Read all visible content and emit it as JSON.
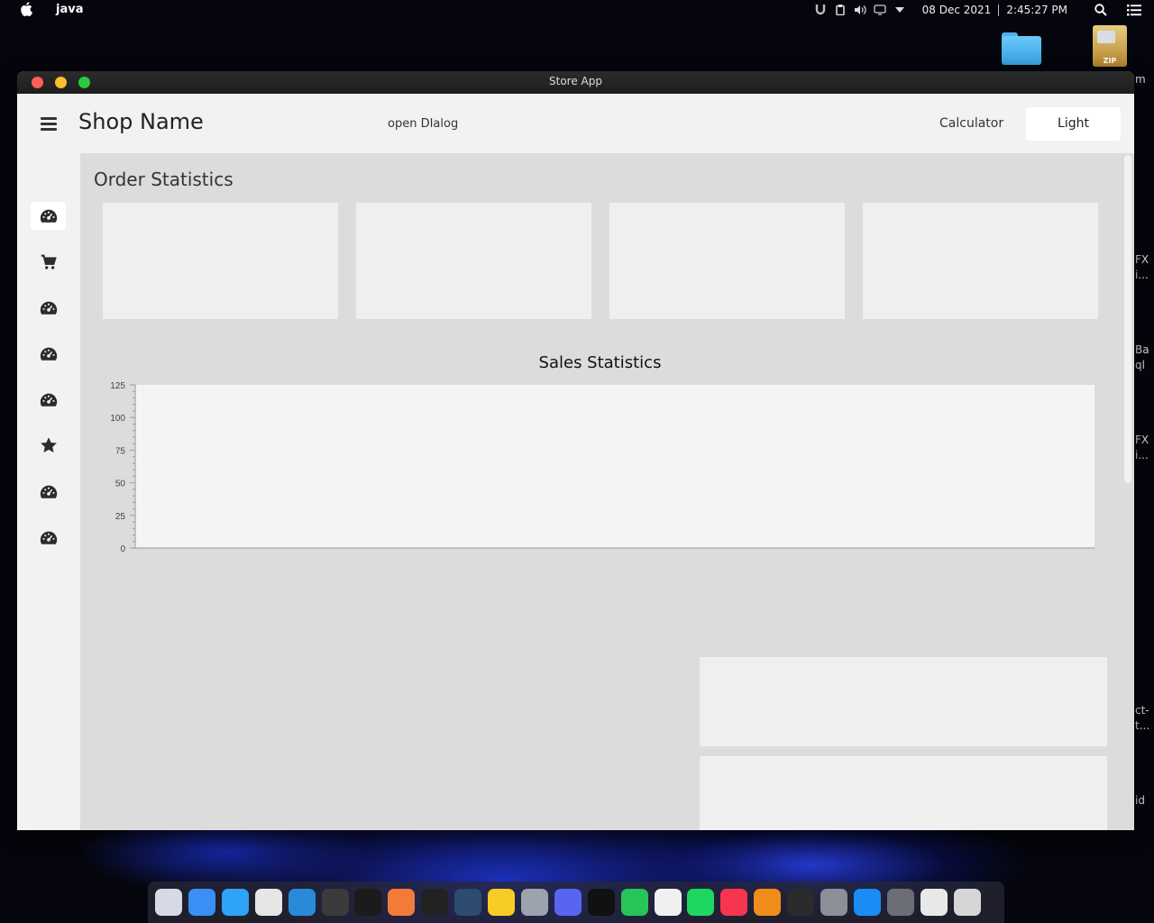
{
  "menubar": {
    "app_name": "java",
    "date": "08 Dec 2021",
    "time": "2:45:27 PM"
  },
  "desktop": {
    "zip_label": "ZIP",
    "peek_texts": [
      "m",
      "FX",
      "i...",
      "Ba",
      "ql",
      "FX",
      "i...",
      "ct-",
      "t...",
      "id"
    ]
  },
  "window": {
    "title": "Store App"
  },
  "header": {
    "shop_name": "Shop Name",
    "open_dialog_label": "open DIalog",
    "calculator_label": "Calculator",
    "theme_button_label": "Light"
  },
  "sidebar": {
    "items": [
      {
        "icon": "dashboard-icon",
        "active": true
      },
      {
        "icon": "cart-icon",
        "active": false
      },
      {
        "icon": "dashboard-icon",
        "active": false
      },
      {
        "icon": "dashboard-icon",
        "active": false
      },
      {
        "icon": "dashboard-icon",
        "active": false
      },
      {
        "icon": "star-icon",
        "active": false
      },
      {
        "icon": "dashboard-icon",
        "active": false
      },
      {
        "icon": "dashboard-icon",
        "active": false
      }
    ]
  },
  "main": {
    "order_statistics_title": "Order Statistics",
    "sales_statistics_title": "Sales Statistics"
  },
  "chart_data": {
    "type": "line",
    "title": "Sales Statistics",
    "xlabel": "",
    "ylabel": "",
    "ylim": [
      0,
      125
    ],
    "y_ticks": [
      "0",
      "25",
      "50",
      "75",
      "100",
      "125"
    ],
    "series": []
  },
  "dock": {
    "apps": [
      {
        "name": "launchpad-icon",
        "color": "#d6d9e6"
      },
      {
        "name": "finder-icon",
        "color": "#3a8ff5"
      },
      {
        "name": "safari-icon",
        "color": "#2fa3f5"
      },
      {
        "name": "chrome-icon",
        "color": "#e6e6e6"
      },
      {
        "name": "vscode-icon",
        "color": "#2a8ad8"
      },
      {
        "name": "sublime-icon",
        "color": "#3b3b3b"
      },
      {
        "name": "intellij-icon",
        "color": "#1b1b1b"
      },
      {
        "name": "postman-icon",
        "color": "#f47a3a"
      },
      {
        "name": "terminal-dev-icon",
        "color": "#222"
      },
      {
        "name": "mysql-workbench-icon",
        "color": "#2e4b70"
      },
      {
        "name": "bee-icon",
        "color": "#f7cc25"
      },
      {
        "name": "database-icon",
        "color": "#9ca3ad"
      },
      {
        "name": "discord-icon",
        "color": "#5865f2"
      },
      {
        "name": "github-icon",
        "color": "#111"
      },
      {
        "name": "whatsapp-icon",
        "color": "#27c458"
      },
      {
        "name": "photos-icon",
        "color": "#f0f0f0"
      },
      {
        "name": "spotify-icon",
        "color": "#1ed760"
      },
      {
        "name": "music-icon",
        "color": "#f7354f"
      },
      {
        "name": "vlc-icon",
        "color": "#f08c1a"
      },
      {
        "name": "terminal-icon",
        "color": "#2b2b2b"
      },
      {
        "name": "settings-icon",
        "color": "#8b8f98"
      },
      {
        "name": "app-store-icon",
        "color": "#1b8cf5"
      },
      {
        "name": "trash-icon",
        "color": "#6b6e74"
      },
      {
        "name": "xquartz-icon",
        "color": "#e8e8e8"
      },
      {
        "name": "screenshot-icon",
        "color": "#d6d6d6"
      }
    ]
  }
}
